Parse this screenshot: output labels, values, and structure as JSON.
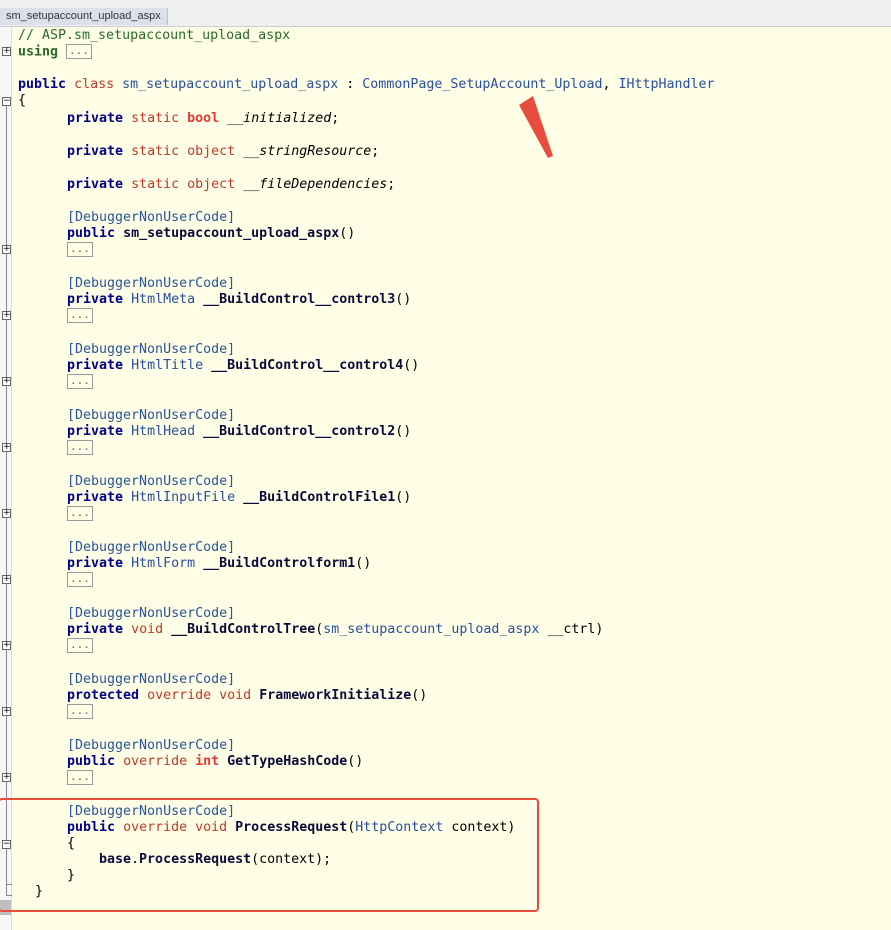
{
  "tab": {
    "label": "sm_setupaccount_upload_aspx"
  },
  "code": {
    "comment": "// ASP.sm_setupaccount_upload_aspx",
    "using_kw": "using",
    "ellipsis": "...",
    "class_line": {
      "public": "public",
      "class": "class",
      "name": "sm_setupaccount_upload_aspx",
      "colon": " : ",
      "base": "CommonPage_SetupAccount_Upload",
      "comma": ", ",
      "iface": "IHttpHandler"
    },
    "open_brace": "{",
    "close_brace": "}",
    "fields": [
      {
        "mod": "private",
        "static": "static",
        "type": "bool",
        "name": "__initialized",
        "end": ";"
      },
      {
        "mod": "private",
        "static": "static",
        "type": "object",
        "name": "__stringResource",
        "end": ";"
      },
      {
        "mod": "private",
        "static": "static",
        "type": "object",
        "name": "__fileDependencies",
        "end": ";"
      }
    ],
    "attribute": "[DebuggerNonUserCode]",
    "methods": [
      {
        "mod": "public",
        "ret": "",
        "name": "sm_setupaccount_upload_aspx",
        "params": "()"
      },
      {
        "mod": "private",
        "ret": "HtmlMeta",
        "name": "__BuildControl__control3",
        "params": "()"
      },
      {
        "mod": "private",
        "ret": "HtmlTitle",
        "name": "__BuildControl__control4",
        "params": "()"
      },
      {
        "mod": "private",
        "ret": "HtmlHead",
        "name": "__BuildControl__control2",
        "params": "()"
      },
      {
        "mod": "private",
        "ret": "HtmlInputFile",
        "name": "__BuildControlFile1",
        "params": "()"
      },
      {
        "mod": "private",
        "ret": "HtmlForm",
        "name": "__BuildControlform1",
        "params": "()"
      },
      {
        "mod": "private",
        "ret": "void",
        "name": "__BuildControlTree",
        "params_open": "(",
        "ptype": "sm_setupaccount_upload_aspx",
        "pname": " __ctrl)"
      },
      {
        "mod": "protected",
        "ovr": "override",
        "ret": "void",
        "name": "FrameworkInitialize",
        "params": "()"
      },
      {
        "mod": "public",
        "ovr": "override",
        "ret": "int",
        "name": "GetTypeHashCode",
        "params": "()"
      },
      {
        "mod": "public",
        "ovr": "override",
        "ret": "void",
        "name": "ProcessRequest",
        "params_open": "(",
        "ptype": "HttpContext",
        "pname": " context)"
      }
    ],
    "body_stmt": {
      "base": "base",
      "dot": ".",
      "call": "ProcessRequest",
      "args": "(context);"
    }
  },
  "colors": {
    "keyword": "#00008b",
    "red_keyword": "#e53935",
    "type": "#2a4f9b",
    "comment": "#2b6a2b",
    "annotation": "#e74c3c"
  }
}
